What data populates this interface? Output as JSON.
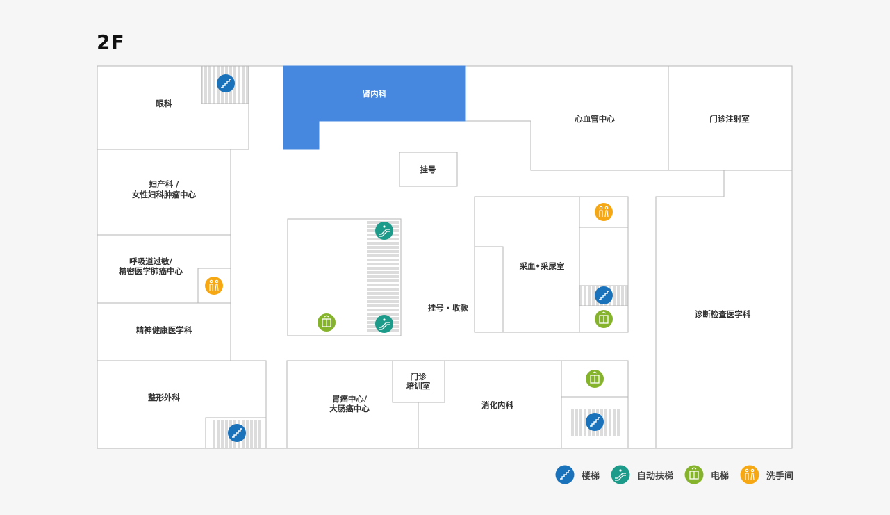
{
  "floor": {
    "label": "2F"
  },
  "rooms": {
    "ophthalmology": "眼科",
    "nephrology": "肾内科",
    "cardiovascular": "心血管中心",
    "outpatient_injection": "门诊注射室",
    "registration": "挂号",
    "gynecology_line1": "妇产科 /",
    "gynecology_line2": "女性妇科肿瘤中心",
    "respiratory_line1": "呼吸道过敏/",
    "respiratory_line2": "精密医学肺癌中心",
    "mental_health": "精神健康医学科",
    "blood_urine": "采血•采尿室",
    "registration_payment": "挂号 · 收款",
    "diagnostic": "诊断检查医学科",
    "plastic_surgery": "整形外科",
    "gastric_line1": "胃癌中心/",
    "gastric_line2": "大肠癌中心",
    "training_line1": "门诊",
    "training_line2": "培训室",
    "gastroenterology": "消化内科"
  },
  "legend": {
    "stairs": "楼梯",
    "escalator": "自动扶梯",
    "elevator": "电梯",
    "restroom": "洗手间"
  },
  "colors": {
    "highlight": "#4688df",
    "stairs": "#1a72bb",
    "escalator": "#1d9b8a",
    "elevator": "#86b32c",
    "restroom": "#f5a814",
    "wall": "#b5b5b5",
    "stripe": "#dcdcdc"
  }
}
